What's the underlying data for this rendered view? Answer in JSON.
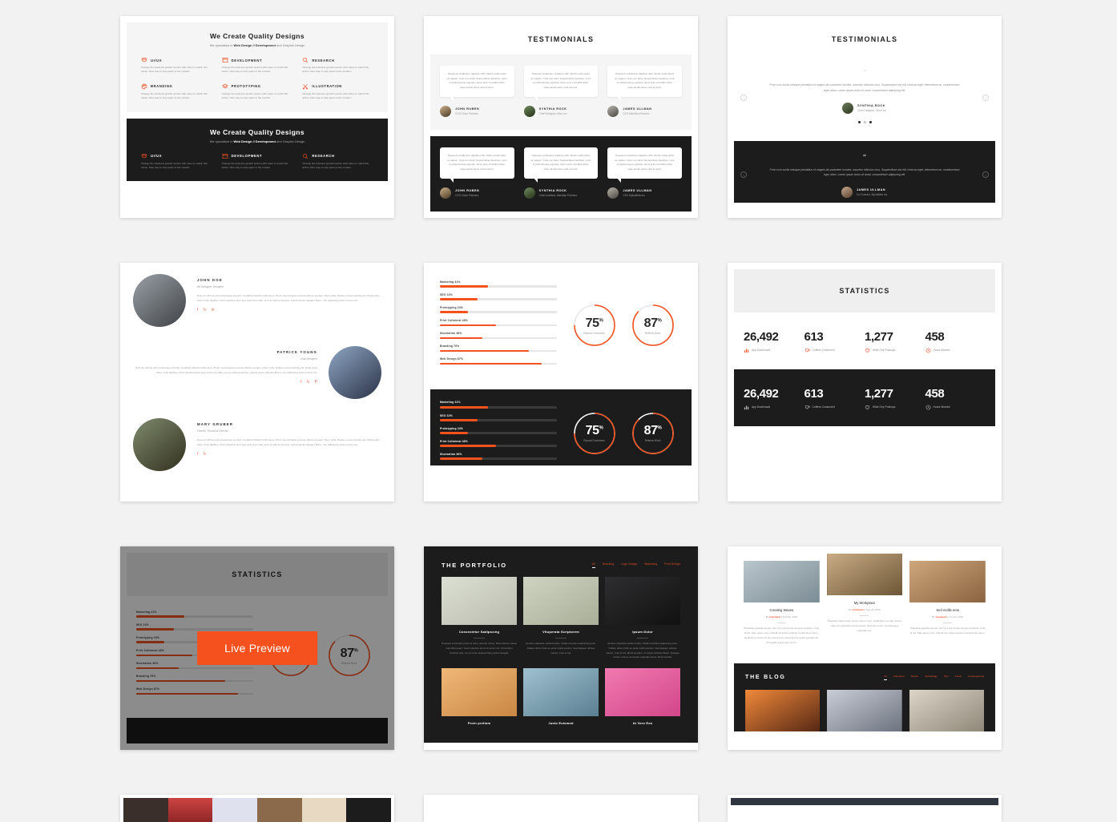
{
  "theme": {
    "accent": "#f04e23",
    "dark": "#1c1c1c",
    "page_bg": "#f2f2f2"
  },
  "services": {
    "title": "We Create Quality Designs",
    "subtitle_pre": "We specialize in ",
    "subtitle_bold": "Web Design // Development",
    "subtitle_post": " and Graphic Design",
    "body": "Change the business growth section with video to match this action. Nice way to stop spam in the contact.",
    "items": [
      {
        "label": "UI/UX",
        "icon": "mask-icon"
      },
      {
        "label": "DEVELOPMENT",
        "icon": "browser-icon"
      },
      {
        "label": "RESEARCH",
        "icon": "search-icon"
      },
      {
        "label": "BRANDING",
        "icon": "palette-icon"
      },
      {
        "label": "PROTOTYPING",
        "icon": "layers-icon"
      },
      {
        "label": "ILLUSTRATION",
        "icon": "scissors-icon"
      }
    ],
    "items_dark": [
      {
        "label": "UI/UX",
        "icon": "mask-icon"
      },
      {
        "label": "DEVELOPMENT",
        "icon": "browser-icon"
      },
      {
        "label": "RESEARCH",
        "icon": "search-icon"
      }
    ]
  },
  "testimonials_grid": {
    "title": "TESTIMONIALS",
    "quote": "Praesent vestibulum dapibus nibh. Morbi mollis tellus ac sapien. Cras non dolor Suspendisse faucibus, nunc et pellentesque egestas, lacus ante convallis tellus, vitae iaculis lacus velit id tortor.",
    "people_light": [
      {
        "name": "JOHN RUBEN",
        "role": "COO Victor Partners"
      },
      {
        "name": "SYNTHIA ROCK",
        "role": "Chief Designer, Altor, Inc"
      },
      {
        "name": "JAMES ULLMAN",
        "role": "CEO Meridian Partners"
      }
    ],
    "people_dark": [
      {
        "name": "JOHN RUBEN",
        "role": "COO Victor Partners"
      },
      {
        "name": "SYNTHIA ROCK",
        "role": "Chief Architect, Meridian Partners"
      },
      {
        "name": "JAMES ULLMAN",
        "role": "CEO AlphaBeta Inc"
      }
    ]
  },
  "testimonial_carousel": {
    "title": "TESTIMONIALS",
    "quote_mark": "“",
    "quote": "Proin cum sociis natoque penatibus et magnis dis parturient montes, nascetur ridiculus mus. Suspendisse nisi elit, rhoncus eget, elementum ac, condimentum eget, diam. Lorem ipsum dolor sit amet, consectetuer adipiscing elit.",
    "person_light": {
      "name": "SYNTHIA ROCK",
      "role": "Chief Designer, Victor Inc."
    },
    "person_dark": {
      "name": "JAMES ULLMAN",
      "role": "Co-Founder, AlphaBeta Inc."
    },
    "arrow_prev": "‹",
    "arrow_next": "›",
    "dots": 3
  },
  "team": {
    "members": [
      {
        "name": "JOHN DOE",
        "role": "Art Designer, Designer",
        "desc": "Duis vel nibh at velit scelerisque suscipit. Curabitur blandit mollis lacus. Proin viverra ligula sit amet ultrices semper. Nunc nulla. Nullam cursus lacinia erat. Nulla porta dolor. Cras dapibus. Proin faucibus arcu quis ante fed mollis, eros et ultrices tempus, mauris ipsum aliquam libero, non adipiscing dolor urna a orci.",
        "socials": [
          "facebook-icon",
          "twitter-icon",
          "linkedin-icon"
        ]
      },
      {
        "name": "PATRICK YOUNG",
        "role": "Lead Designer",
        "desc": "Duis vel nibh at velit scelerisque suscipit. Curabitur blandit mollis lacus. Proin viverra ligula sit amet ultrices semper. Nunc nulla. Nullam cursus lacinia erat. Nulla porta dolor. Cras dapibus. Proin faucibus arcu quis ante fed mollis, eros et ultrices tempus, mauris ipsum aliquam libero, non adipiscing dolor urna a orci.",
        "socials": [
          "facebook-icon",
          "twitter-icon",
          "pinterest-icon"
        ]
      },
      {
        "name": "MARY GRUBER",
        "role": "Partner, Technical Director",
        "desc": "Duis vel nibh at velit scelerisque suscipit. Curabitur blandit mollis lacus. Proin viverra ligula sit amet ultrices semper. Nunc nulla. Nullam cursus lacinia erat. Nulla porta dolor. Cras dapibus. Proin faucibus arcu quis ante fed mollis, eros et ultrices tempus, mauris ipsum aliquam libero, non adipiscing dolor urna a orci.",
        "socials": [
          "facebook-icon",
          "twitter-icon"
        ]
      }
    ]
  },
  "chart_data": [
    {
      "type": "bar",
      "title": "Skills",
      "orientation": "horizontal",
      "categories": [
        "Marketing",
        "SEO",
        "Prototyping",
        "Print Collateral",
        "Illustration",
        "Branding",
        "Web Design"
      ],
      "values": [
        41,
        32,
        24,
        48,
        36,
        76,
        87
      ],
      "labels": [
        "Marketing 41%",
        "SEO 32%",
        "Prototyping 24%",
        "Print Collateral 48%",
        "Illustration 36%",
        "Branding 76%",
        "Web Design 87%"
      ],
      "ylim": [
        0,
        100
      ],
      "grid": false,
      "xlabel": "",
      "ylabel": ""
    },
    {
      "type": "pie",
      "variant": "donut-gauge",
      "title": "Repeat Customers",
      "categories": [
        "Repeat Customers"
      ],
      "values": [
        75
      ],
      "display": "75",
      "suffix": "%",
      "caption": "Repeat Customers",
      "ylim": [
        0,
        100
      ]
    },
    {
      "type": "pie",
      "variant": "donut-gauge",
      "title": "Referral Work",
      "categories": [
        "Referral Work"
      ],
      "values": [
        87
      ],
      "display": "87",
      "suffix": "%",
      "caption": "Referral Work",
      "ylim": [
        0,
        100
      ]
    },
    {
      "type": "bar",
      "title": "Statistics",
      "categories": [
        "App Downloads",
        "Coffees Consumed",
        "Wide Grip Pushups",
        "Hours Worked"
      ],
      "values": [
        26492,
        613,
        1277,
        458
      ],
      "labels": [
        "26,492",
        "613",
        "1,277",
        "458"
      ],
      "grid": false
    }
  ],
  "statistics": {
    "banner": "STATISTICS",
    "items": [
      {
        "value": "26,492",
        "label": "App Downloads",
        "icon": "bar-chart-icon"
      },
      {
        "value": "613",
        "label": "Coffees Consumed",
        "icon": "coffee-icon"
      },
      {
        "value": "1,277",
        "label": "Wide Grip Pushups",
        "icon": "heart-icon"
      },
      {
        "value": "458",
        "label": "Hours Worked",
        "icon": "clock-icon"
      }
    ]
  },
  "hover_card": {
    "banner": "STATISTICS",
    "button_label": "Live Preview"
  },
  "portfolio": {
    "title": "THE PORTFOLIO",
    "nav": [
      "All",
      "Branding",
      "Logo Design",
      "Marketing",
      "Print Design"
    ],
    "active_nav": "All",
    "items_top": [
      {
        "name": "Consectetur Sadipscing",
        "desc": "Praesent venenatis metus at tortor pulvinar varius. Duis lobortis massa imperdiet quam. Nunc interdum lacus sit amet orci. Ut tincidunt tincidunt erat. Ut non enim eleifend felis pretium feugiat."
      },
      {
        "name": "Vituperata Scriptorem",
        "desc": "Aenean vulputate eleifend tellus. Nullam tincidunt adipiscing enim. Nullam dictum felis eu pede mollis pretium. Sed aliquam ultrices mauris. Cras id dui."
      },
      {
        "name": "Ipsum Dolor",
        "desc": "Aenean vulputate eleifend tellus. Nullam tincidunt adipiscing enim. Nullam dictum felis eu pede mollis pretium. Sed aliquam ultrices mauris. Cras id dui. Morbi at tellus. Ut varius tincidunt libero. Quisque rutrum. Donec venenatis vulputate lorem. Morbi at felis."
      }
    ],
    "items_bottom": [
      {
        "name": "Proin pretium"
      },
      {
        "name": "Justo Euismod"
      },
      {
        "name": "At Vero Eos"
      }
    ]
  },
  "blog": {
    "posts": [
      {
        "title": "Creating Waves",
        "by_prefix": "By ",
        "author": "Livemesh",
        "sep": "//",
        "date": "Feb 02, 2016",
        "desc": "Phasellus gravida semper nisl. Ut a nisl id ante tempus hendrerit. Cras id dui. Nam quam nunc, blandit vel luctus pulvinar, hendrerit at, lorem. Vestibulum rutrum mi nec elementum vehicula eros quam gravida nisl, id fringilla neque ante vel mi."
      },
      {
        "title": "My Workplace",
        "by_prefix": "By ",
        "author": "Livemesh",
        "sep": "//",
        "date": "Sep 29, 2016",
        "desc": "Phasellus ullamcorper ipsum rutrum nunc. Vestibulum eu odio. Donec vitae orci sed dolor rutrum auctor. Duis arcu tortor, suscipit eget, imperdiet nec."
      },
      {
        "title": "Sed mollis eros",
        "by_prefix": "By ",
        "author": "Livemesh",
        "sep": "//",
        "date": "Jun 23, 2016",
        "desc": "Phasellus gravida semper nisl. Ut a nisl id ante tempus hendrerit. Cras id dui. Nam quam nunc, blandit vel, luctus pulvinar, hendrerit at, lorem."
      }
    ],
    "dark_title": "THE BLOG",
    "nav": [
      "All",
      "Adventure",
      "Nature",
      "Technology",
      "Tips",
      "Travel",
      "Uncategorized"
    ],
    "active_nav": "All"
  }
}
